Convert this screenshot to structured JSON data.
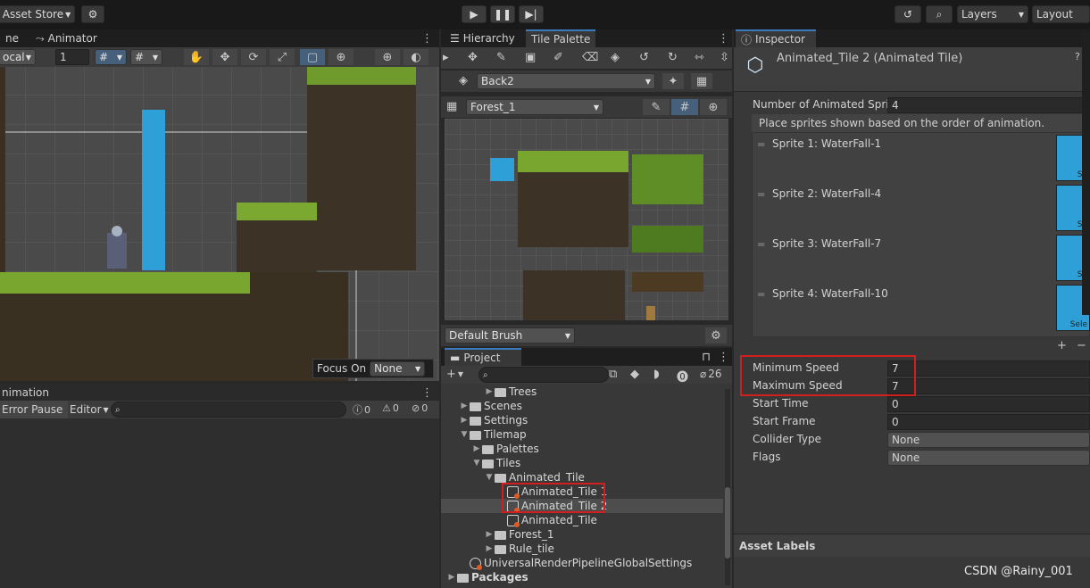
{
  "toolbar": {
    "asset_store_label": "Asset Store",
    "layers_label": "Layers",
    "layout_label": "Layout"
  },
  "scene": {
    "tab_partial": "ne",
    "animator_tab": "Animator",
    "pivot_mode": "ocal",
    "grid_value": "1",
    "focus_on_label": "Focus On",
    "focus_value": "None"
  },
  "animation": {
    "title": "nimation",
    "error_pause": "Error Pause",
    "editor_label": "Editor",
    "log_count": "0",
    "warn_count": "0",
    "error_count": "0"
  },
  "hierarchy_tab": "Hierarchy",
  "tile_palette": {
    "tab": "Tile Palette",
    "layer": "Back2",
    "palette": "Forest_1",
    "brush": "Default Brush"
  },
  "project": {
    "tab": "Project",
    "hidden_count": "26",
    "tree": [
      {
        "label": "Trees",
        "indent": 3,
        "arrow": "▶",
        "type": "folder"
      },
      {
        "label": "Scenes",
        "indent": 1,
        "arrow": "▶",
        "type": "folder"
      },
      {
        "label": "Settings",
        "indent": 1,
        "arrow": "▶",
        "type": "folder"
      },
      {
        "label": "Tilemap",
        "indent": 1,
        "arrow": "▼",
        "type": "folder"
      },
      {
        "label": "Palettes",
        "indent": 2,
        "arrow": "▶",
        "type": "folder"
      },
      {
        "label": "Tiles",
        "indent": 2,
        "arrow": "▼",
        "type": "folder"
      },
      {
        "label": "Animated_Tile",
        "indent": 3,
        "arrow": "▼",
        "type": "folder"
      },
      {
        "label": "Animated_Tile 1",
        "indent": 4,
        "arrow": "",
        "type": "tile"
      },
      {
        "label": "Animated_Tile 2",
        "indent": 4,
        "arrow": "",
        "type": "tile"
      },
      {
        "label": "Animated_Tile",
        "indent": 4,
        "arrow": "",
        "type": "tile"
      },
      {
        "label": "Forest_1",
        "indent": 3,
        "arrow": "▶",
        "type": "folder"
      },
      {
        "label": "Rule_tile",
        "indent": 3,
        "arrow": "▶",
        "type": "folder"
      },
      {
        "label": "UniversalRenderPipelineGlobalSettings",
        "indent": 1,
        "arrow": "",
        "type": "asset"
      },
      {
        "label": "Packages",
        "indent": 0,
        "arrow": "▶",
        "type": "folder"
      }
    ]
  },
  "inspector": {
    "tab": "Inspector",
    "object_title": "Animated_Tile 2 (Animated Tile)",
    "num_sprites_label": "Number of Animated Sprit",
    "num_sprites_value": "4",
    "hint": "Place sprites shown based on the order of animation.",
    "sprites": [
      {
        "label": "Sprite 1: WaterFall-1"
      },
      {
        "label": "Sprite 2: WaterFall-4"
      },
      {
        "label": "Sprite 3: WaterFall-7"
      },
      {
        "label": "Sprite 4: WaterFall-10"
      }
    ],
    "sprite_thumb_label": "Se",
    "sprite_thumb_label_last": "Sele",
    "props": [
      {
        "label": "Minimum Speed",
        "value": "7",
        "kind": "field"
      },
      {
        "label": "Maximum Speed",
        "value": "7",
        "kind": "field"
      },
      {
        "label": "Start Time",
        "value": "0",
        "kind": "field"
      },
      {
        "label": "Start Frame",
        "value": "0",
        "kind": "field"
      },
      {
        "label": "Collider Type",
        "value": "None",
        "kind": "drop"
      },
      {
        "label": "Flags",
        "value": "None",
        "kind": "drop"
      }
    ],
    "asset_labels": "Asset Labels"
  },
  "watermark": "CSDN @Rainy_001",
  "colors": {
    "accent": "#3a79bb",
    "highlight": "#d11f1f",
    "water": "#2f9fd8",
    "grass": "#6fa02a"
  }
}
